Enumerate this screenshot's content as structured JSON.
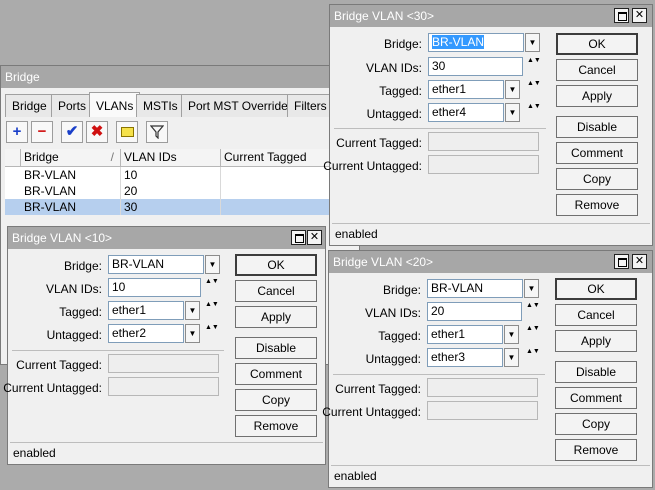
{
  "bridge_window": {
    "title": "Bridge",
    "tabs": [
      "Bridge",
      "Ports",
      "VLANs",
      "MSTIs",
      "Port MST Overrides",
      "Filters"
    ],
    "active_tab": "VLANs",
    "columns": [
      "Bridge",
      "VLAN IDs",
      "Current Tagged"
    ],
    "rows": [
      {
        "bridge": "BR-VLAN",
        "vlan_ids": "10",
        "tagged": ""
      },
      {
        "bridge": "BR-VLAN",
        "vlan_ids": "20",
        "tagged": ""
      },
      {
        "bridge": "BR-VLAN",
        "vlan_ids": "30",
        "tagged": ""
      }
    ],
    "sort_indicator": "/"
  },
  "labels": {
    "bridge": "Bridge:",
    "vlan_ids": "VLAN IDs:",
    "tagged": "Tagged:",
    "untagged": "Untagged:",
    "current_tagged": "Current Tagged:",
    "current_untagged": "Current Untagged:"
  },
  "buttons": {
    "ok": "OK",
    "cancel": "Cancel",
    "apply": "Apply",
    "disable": "Disable",
    "comment": "Comment",
    "copy": "Copy",
    "remove": "Remove"
  },
  "dialog30": {
    "title": "Bridge VLAN <30>",
    "bridge": "BR-VLAN",
    "vlan_ids": "30",
    "tagged": "ether1",
    "untagged": "ether4",
    "status": "enabled"
  },
  "dialog10": {
    "title": "Bridge VLAN <10>",
    "bridge": "BR-VLAN",
    "vlan_ids": "10",
    "tagged": "ether1",
    "untagged": "ether2",
    "status": "enabled"
  },
  "dialog20": {
    "title": "Bridge VLAN <20>",
    "bridge": "BR-VLAN",
    "vlan_ids": "20",
    "tagged": "ether1",
    "untagged": "ether3",
    "status": "enabled"
  },
  "glyphs": {
    "close": "✕",
    "dropdown": "▼",
    "updown": "▲▼"
  },
  "icons": [
    "add-icon",
    "remove-icon",
    "enable-icon",
    "disable-icon",
    "comment-icon",
    "filter-icon"
  ]
}
